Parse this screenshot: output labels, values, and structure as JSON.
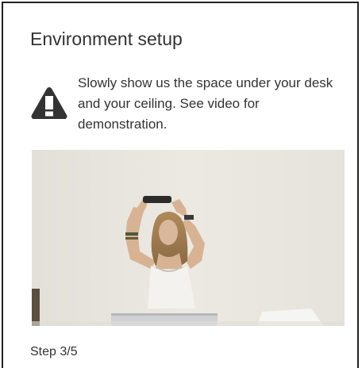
{
  "panel": {
    "title": "Environment setup",
    "warning": {
      "icon": "warning-triangle-icon",
      "text": "Slowly show us the space under your desk and your ceiling. See video for demonstration."
    },
    "video": {
      "description_icon": "demonstration-video"
    },
    "step_label": "Step 3/5"
  },
  "colors": {
    "text": "#333333",
    "icon": "#333333",
    "border": "#222222",
    "wall": "#e8e5de"
  }
}
